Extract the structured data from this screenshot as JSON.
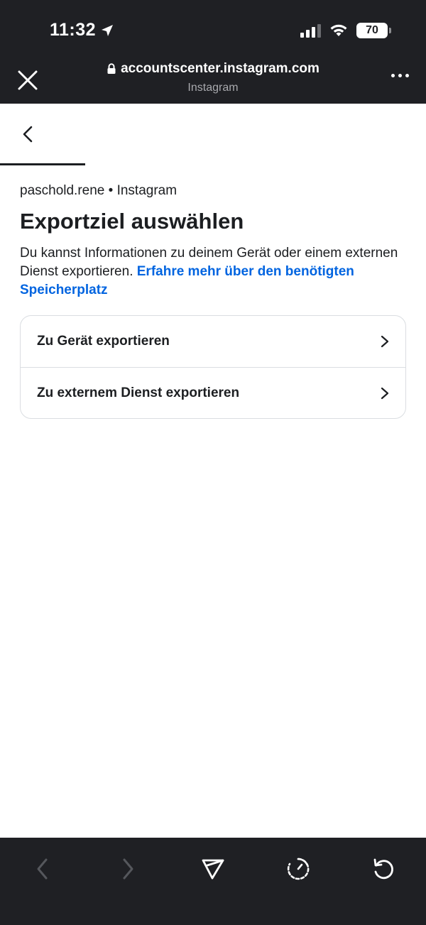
{
  "status_bar": {
    "time": "11:32",
    "battery": "70",
    "location_icon": "location-arrow-icon",
    "signal_icon": "cellular-signal-icon",
    "wifi_icon": "wifi-icon"
  },
  "browser_header": {
    "url": "accountscenter.instagram.com",
    "site_name": "Instagram",
    "close_icon": "close-icon",
    "lock_icon": "lock-icon",
    "more_icon": "more-horizontal-icon"
  },
  "page": {
    "back_icon": "chevron-left-icon",
    "account_line": "paschold.rene • Instagram",
    "title": "Exportziel auswählen",
    "description_text": "Du kannst Informationen zu deinem Gerät oder einem externen Dienst exportieren.",
    "description_link": "Erfahre mehr über den benötigten Speicherplatz",
    "options": [
      {
        "label": "Zu Gerät exportieren",
        "icon": "chevron-right-icon"
      },
      {
        "label": "Zu externem Dienst exportieren",
        "icon": "chevron-right-icon"
      }
    ]
  },
  "toolbar": {
    "items": [
      "back-arrow-icon",
      "forward-arrow-icon",
      "send-icon",
      "timer-icon",
      "reload-icon"
    ]
  },
  "colors": {
    "chrome_bg": "#1f2024",
    "link": "#0064e0",
    "text": "#1c1e21",
    "divider": "#dadde1"
  }
}
